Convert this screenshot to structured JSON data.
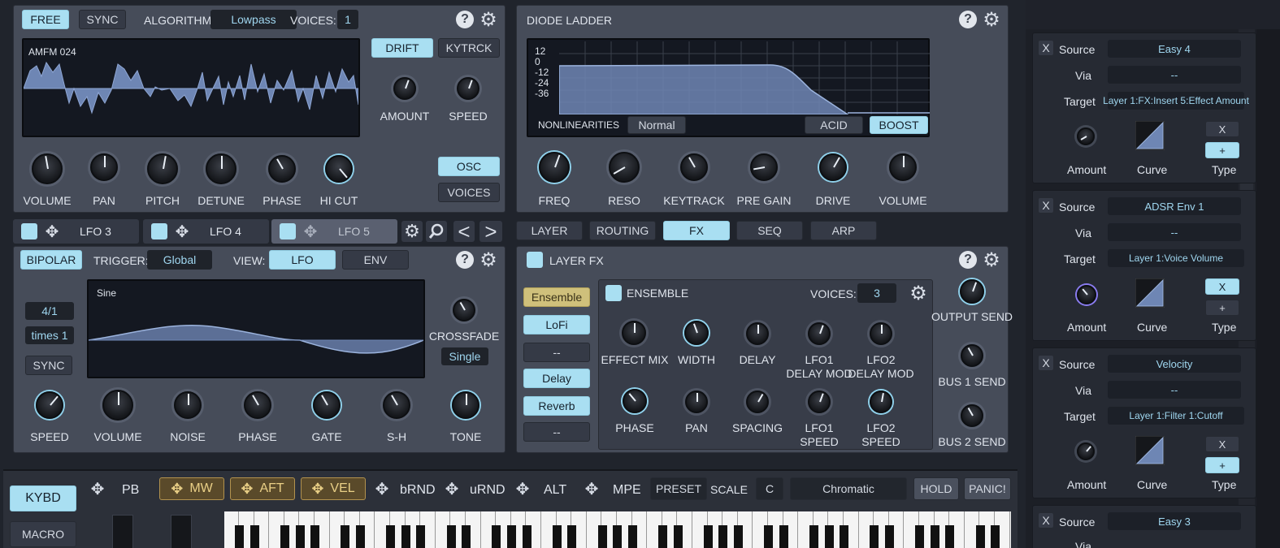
{
  "osc": {
    "free": "FREE",
    "sync": "SYNC",
    "algorithm_label": "ALGORITHM:",
    "algorithm": "Lowpass",
    "voices_label": "VOICES:",
    "voices": "1",
    "wave_name": "AMFM 024",
    "drift": "DRIFT",
    "kytrck": "KYTRCK",
    "amount": "AMOUNT",
    "speed": "SPEED",
    "knobs": [
      "VOLUME",
      "PAN",
      "PITCH",
      "DETUNE",
      "PHASE",
      "HI CUT"
    ],
    "osc_btn": "OSC",
    "voices_btn": "VOICES"
  },
  "filter": {
    "title": "DIODE LADDER",
    "db_ticks": [
      "12",
      "0",
      "-12",
      "-24",
      "-36"
    ],
    "nonlin_label": "NONLINEARITIES",
    "nonlin": "Normal",
    "acid": "ACID",
    "boost": "BOOST",
    "knobs": [
      "FREQ",
      "RESO",
      "KEYTRACK",
      "PRE GAIN",
      "DRIVE",
      "VOLUME"
    ]
  },
  "lfo_tabs": [
    "LFO 3",
    "LFO 4",
    "LFO 5"
  ],
  "lfo": {
    "bipolar": "BIPOLAR",
    "trigger_label": "TRIGGER:",
    "trigger": "Global",
    "view_label": "VIEW:",
    "lfo": "LFO",
    "env": "ENV",
    "rate": "4/1",
    "times": "times 1",
    "sync": "SYNC",
    "wave_name": "Sine",
    "crossfade": "CROSSFADE",
    "single": "Single",
    "knobs": [
      "SPEED",
      "VOLUME",
      "NOISE",
      "PHASE",
      "GATE",
      "S-H",
      "TONE"
    ]
  },
  "tabs": [
    "LAYER",
    "ROUTING",
    "FX",
    "SEQ",
    "ARP"
  ],
  "fx": {
    "title": "LAYER FX",
    "slots": [
      "Ensemble",
      "LoFi",
      "--",
      "Delay",
      "Reverb",
      "--"
    ],
    "ensemble_title": "ENSEMBLE",
    "voices_label": "VOICES:",
    "voices": "3",
    "knobs_row1": [
      "EFFECT MIX",
      "WIDTH",
      "DELAY",
      "LFO1\nDELAY MOD",
      "LFO2\nDELAY MOD"
    ],
    "knobs_row2": [
      "PHASE",
      "PAN",
      "SPACING",
      "LFO1\nSPEED",
      "LFO2\nSPEED"
    ],
    "sends": [
      "OUTPUT SEND",
      "BUS 1 SEND",
      "BUS 2 SEND"
    ]
  },
  "keyboard": {
    "kybd": "KYBD",
    "macro": "MACRO",
    "pb": "PB",
    "mw": "MW",
    "aft": "AFT",
    "vel": "VEL",
    "brnd": "bRND",
    "urnd": "uRND",
    "alt": "ALT",
    "mpe": "MPE",
    "preset": "PRESET",
    "scale": "SCALE",
    "key": "C",
    "scale_name": "Chromatic",
    "hold": "HOLD",
    "panic": "PANIC!"
  },
  "mods": [
    {
      "x": "X",
      "source_label": "Source",
      "source": "Easy 4",
      "via_label": "Via",
      "via": "--",
      "target_label": "Target",
      "target": "Layer 1:FX:Insert 5:Effect Amount",
      "amount": "Amount",
      "curve": "Curve",
      "type": "Type",
      "type_x": "X",
      "type_plus": "+"
    },
    {
      "x": "X",
      "source_label": "Source",
      "source": "ADSR Env 1",
      "via_label": "Via",
      "via": "--",
      "target_label": "Target",
      "target": "Layer 1:Voice Volume",
      "amount": "Amount",
      "curve": "Curve",
      "type": "Type",
      "type_x": "X",
      "type_plus": "+"
    },
    {
      "x": "X",
      "source_label": "Source",
      "source": "Velocity",
      "via_label": "Via",
      "via": "--",
      "target_label": "Target",
      "target": "Layer 1:Filter 1:Cutoff",
      "amount": "Amount",
      "curve": "Curve",
      "type": "Type",
      "type_x": "X",
      "type_plus": "+"
    },
    {
      "x": "X",
      "source_label": "Source",
      "source": "Easy 3",
      "via_label": "Via"
    }
  ]
}
